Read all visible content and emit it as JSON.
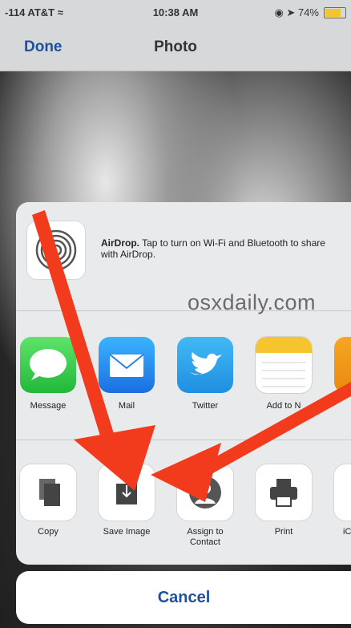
{
  "status_bar": {
    "carrier": "-114 AT&T ≈",
    "time": "10:38 AM",
    "right_status": "◉ ➤ 74%"
  },
  "navbar": {
    "done_label": "Done",
    "title": "Photo"
  },
  "airdrop": {
    "title": "AirDrop.",
    "text": " Tap to turn on Wi-Fi and Bluetooth to share with AirDrop."
  },
  "watermark": "osxdaily.com",
  "share_apps": [
    {
      "label": "Message",
      "icon": "message-icon"
    },
    {
      "label": "Mail",
      "icon": "mail-icon"
    },
    {
      "label": "Twitter",
      "icon": "twitter-icon"
    },
    {
      "label": "Add to N",
      "icon": "notes-icon"
    }
  ],
  "actions": [
    {
      "label": "Copy",
      "icon": "copy-icon"
    },
    {
      "label": "Save Image",
      "icon": "save-image-icon"
    },
    {
      "label": "Assign to Contact",
      "icon": "assign-contact-icon"
    },
    {
      "label": "Print",
      "icon": "print-icon"
    },
    {
      "label": "iC",
      "icon": "icloud-icon"
    }
  ],
  "cancel_label": "Cancel",
  "colors": {
    "accent": "#1f4f9e",
    "arrow": "#f23a1c",
    "sheet": "#e9eaec"
  }
}
